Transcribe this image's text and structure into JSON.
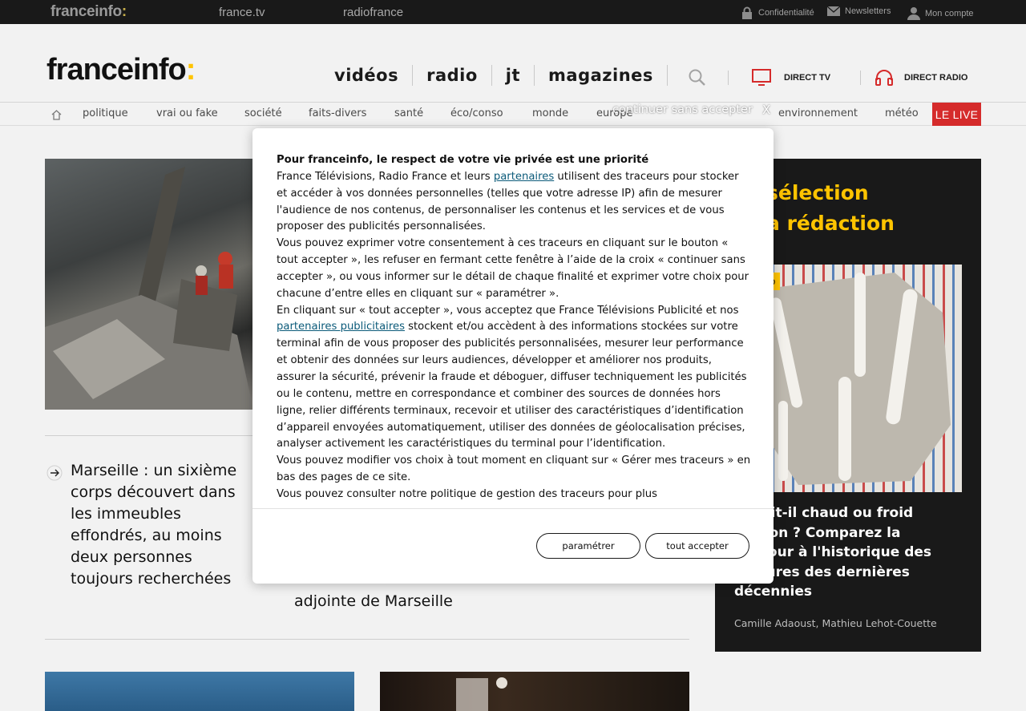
{
  "topbar": {
    "logo": "franceinfo",
    "logo_colon": ":",
    "links": [
      "france.tv",
      "radiofrance"
    ],
    "privacy": "Confidentialité",
    "newsletters": "Newsletters",
    "account": "Mon compte"
  },
  "header": {
    "brand": "franceinfo",
    "brand_colon": ":",
    "nav": [
      "vidéos",
      "radio",
      "jt",
      "magazines"
    ],
    "direct_tv": "DIRECT TV",
    "direct_radio": "DIRECT RADIO"
  },
  "subnav": {
    "items": [
      "politique",
      "vrai ou fake",
      "société",
      "faits-divers",
      "santé",
      "éco/conso",
      "monde",
      "europe",
      "",
      "",
      "environnement",
      "météo"
    ],
    "live": "LE LIVE"
  },
  "content": {
    "headline1": "Marseille : un sixième corps découvert dans les immeubles effondrés, au moins deux personnes toujours recherchées",
    "headline2_partial": "adjointe de Marseille"
  },
  "selection": {
    "title": "sélection\na rédaction",
    "badge": "éo",
    "headline": "t : fait-il chaud ou froid\n saison ? Comparez la\n du jour à l'historique des\nératures des dernières\ndécennies",
    "authors": "Camille Adaoust, Mathieu Lehot-Couette"
  },
  "consent": {
    "continue_label": "continuer sans accepter",
    "close_label": "X",
    "heading": "Pour franceinfo, le respect de votre vie privée est une priorité",
    "p1_before": "France Télévisions, Radio France et leurs ",
    "p1_link": "partenaires",
    "p1_after": " utilisent des traceurs pour stocker et accéder à vos données personnelles (telles que votre adresse IP) afin de mesurer l'audience de nos contenus, de personnaliser les contenus et les services et de vous proposer des publicités personnalisées.",
    "p2": "Vous pouvez exprimer votre consentement à ces traceurs en cliquant sur le bouton « tout accepter », les refuser en fermant cette fenêtre à l’aide de la croix « continuer sans accepter », ou vous informer sur le détail de chaque finalité et exprimer votre choix pour chacune d’entre elles en cliquant sur « paramétrer ».",
    "p3_before": "En cliquant sur « tout accepter », vous acceptez que France Télévisions Publicité et nos ",
    "p3_link": "partenaires publicitaires",
    "p3_after": " stockent et/ou accèdent à des informations stockées sur votre terminal afin de vous proposer des publicités personnalisées, mesurer leur performance et obtenir des données sur leurs audiences, développer et améliorer nos produits, assurer la sécurité, prévenir la fraude et déboguer, diffuser techniquement les publicités ou le contenu, mettre en correspondance et combiner des sources de données hors ligne, relier différents terminaux, recevoir et utiliser des caractéristiques d’identification d’appareil envoyées automatiquement, utiliser des données de géolocalisation précises, analyser activement les caractéristiques du terminal pour l’identification.",
    "p4": "Vous pouvez modifier vos choix à tout moment en cliquant sur « Gérer mes traceurs » en bas des pages de ce site.",
    "p5": "Vous pouvez consulter notre politique de gestion des traceurs pour plus",
    "btn_settings": "paramétrer",
    "btn_accept": "tout accepter"
  }
}
